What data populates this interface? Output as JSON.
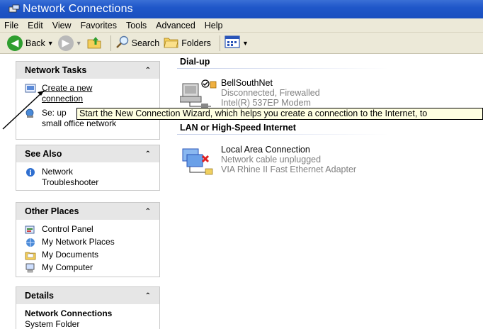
{
  "window": {
    "title": "Network Connections"
  },
  "menu": [
    "File",
    "Edit",
    "View",
    "Favorites",
    "Tools",
    "Advanced",
    "Help"
  ],
  "toolbar": {
    "back": "Back",
    "search": "Search",
    "folders": "Folders"
  },
  "network_tasks": {
    "title": "Network Tasks",
    "items": [
      {
        "label": "Create a new connection",
        "line1": "Create a new",
        "line2": "connection",
        "icon": "new-connection-icon"
      },
      {
        "label": "Set up a home or small office network",
        "line1": "Se: up",
        "line2": "small office network",
        "icon": "home-network-icon"
      }
    ]
  },
  "see_also": {
    "title": "See Also",
    "items": [
      {
        "line1": "Network",
        "line2": "Troubleshooter",
        "icon": "help-icon"
      }
    ]
  },
  "other_places": {
    "title": "Other Places",
    "items": [
      {
        "label": "Control Panel",
        "icon": "control-panel-icon"
      },
      {
        "label": "My Network Places",
        "icon": "network-places-icon"
      },
      {
        "label": "My Documents",
        "icon": "documents-folder-icon"
      },
      {
        "label": "My Computer",
        "icon": "computer-icon"
      }
    ]
  },
  "details": {
    "title": "Details",
    "name": "Network Connections",
    "type": "System Folder"
  },
  "groups": {
    "dialup": {
      "title": "Dial-up",
      "connections": [
        {
          "name": "BellSouthNet",
          "status": "Disconnected, Firewalled",
          "device": "Intel(R) 537EP Modem"
        }
      ]
    },
    "lan": {
      "title": "LAN or High-Speed Internet",
      "connections": [
        {
          "name": "Local Area Connection",
          "status": "Network cable unplugged",
          "device": "VIA Rhine II Fast Ethernet Adapter"
        }
      ]
    }
  },
  "tooltip": "Start the New Connection Wizard, which helps you create a connection to the Internet, to"
}
